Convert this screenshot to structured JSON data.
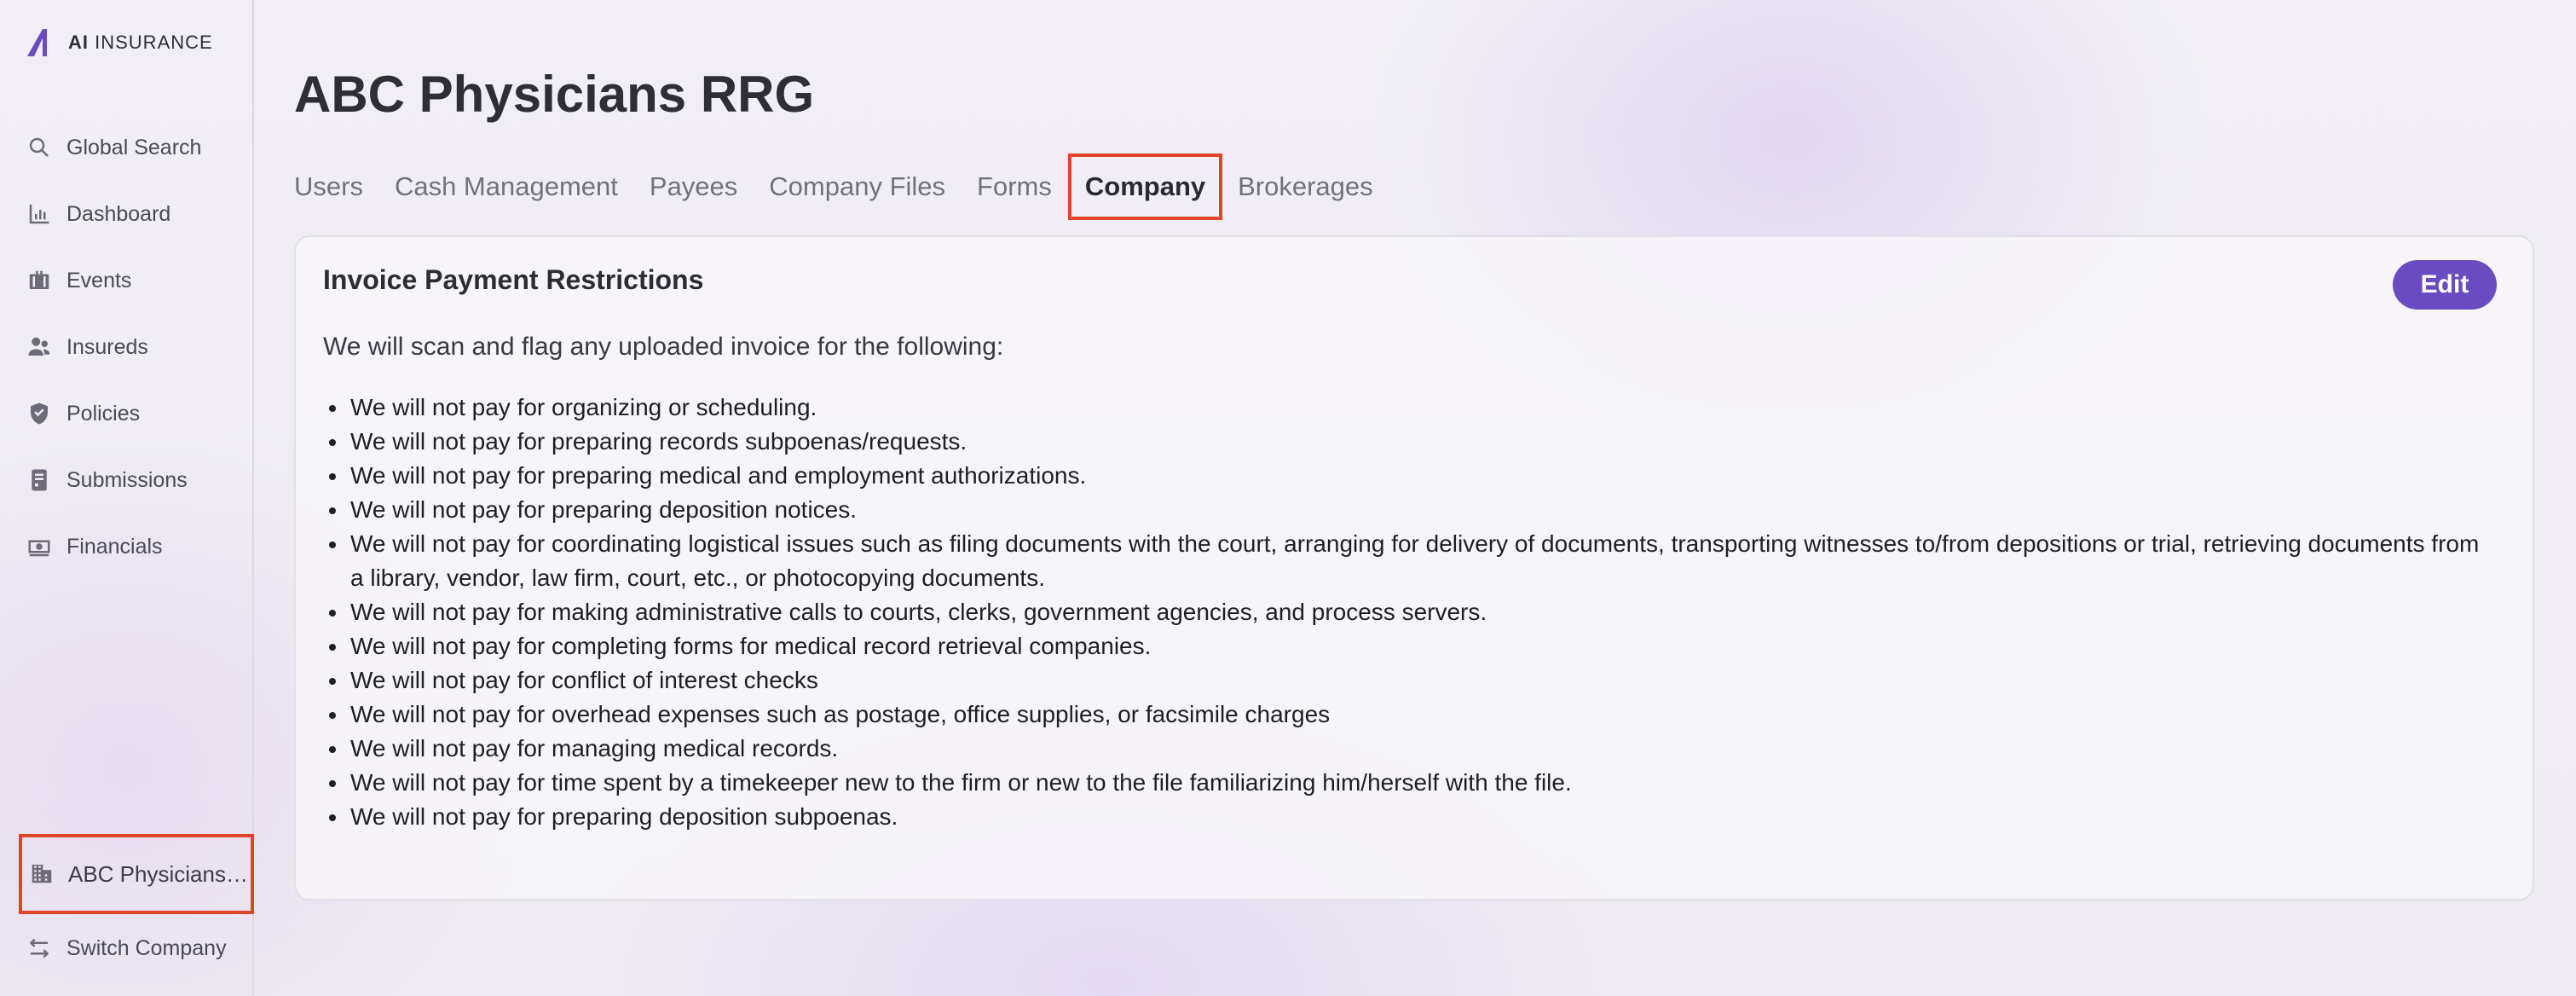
{
  "app": {
    "logo_brand": "AI",
    "logo_suffix": "INSURANCE"
  },
  "sidebar": {
    "items": [
      {
        "label": "Global Search",
        "icon": "search-icon"
      },
      {
        "label": "Dashboard",
        "icon": "chart-bar-icon"
      },
      {
        "label": "Events",
        "icon": "briefcase-icon"
      },
      {
        "label": "Insureds",
        "icon": "users-icon"
      },
      {
        "label": "Policies",
        "icon": "shield-check-icon"
      },
      {
        "label": "Submissions",
        "icon": "document-icon"
      },
      {
        "label": "Financials",
        "icon": "money-icon"
      }
    ],
    "company": {
      "label": "ABC Physicians RRG",
      "icon": "building-icon"
    },
    "switch": {
      "label": "Switch Company",
      "icon": "swap-arrows-icon"
    }
  },
  "page": {
    "title": "ABC Physicians RRG",
    "tabs": [
      "Users",
      "Cash Management",
      "Payees",
      "Company Files",
      "Forms",
      "Company",
      "Brokerages"
    ],
    "active_tab": "Company"
  },
  "card": {
    "title": "Invoice Payment Restrictions",
    "edit_label": "Edit",
    "intro": "We will scan and flag any uploaded invoice for the following:",
    "rules": [
      "We will not pay for organizing or scheduling.",
      "We will not pay for preparing records subpoenas/requests.",
      "We will not pay for preparing medical and employment authorizations.",
      "We will not pay for preparing deposition notices.",
      "We will not pay for coordinating logistical issues such as filing documents with the court, arranging for delivery of documents, transporting witnesses to/from depositions or trial, retrieving documents from a library, vendor, law firm, court, etc., or photocopying documents.",
      "We will not pay for making administrative calls to courts, clerks, government agencies, and process servers.",
      "We will not pay for completing forms for medical record retrieval companies.",
      "We will not pay for conflict of interest checks",
      "We will not pay for overhead expenses such as postage, office supplies, or facsimile charges",
      "We will not pay for managing medical records.",
      "We will not pay for time spent by a timekeeper new to the firm or new to the file familiarizing him/herself with the file.",
      "We will not pay for preparing deposition subpoenas."
    ]
  },
  "colors": {
    "accent": "#6b4bc1",
    "highlight": "#e0452c"
  }
}
